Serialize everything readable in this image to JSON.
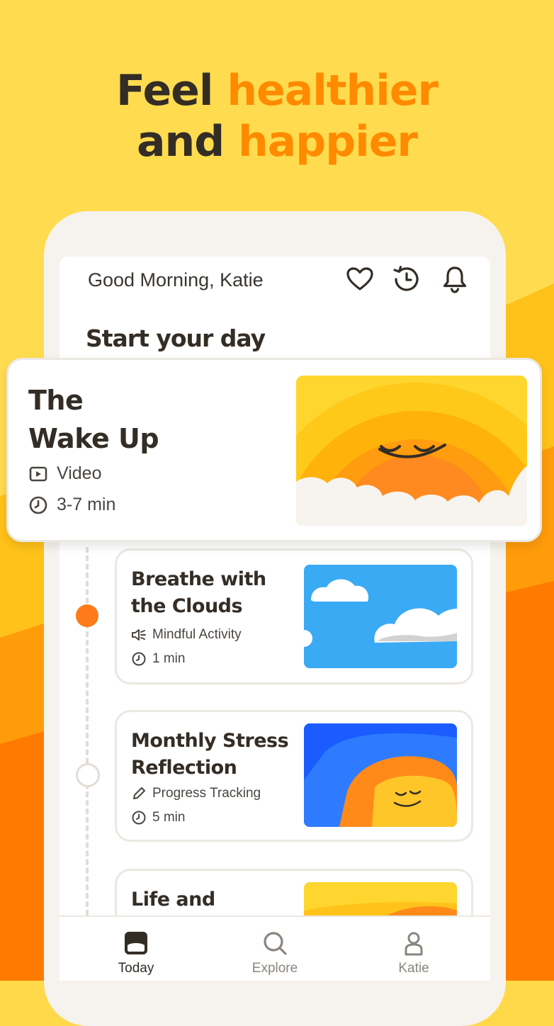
{
  "hero": {
    "line1_plain": "Feel ",
    "line1_accent": "healthier",
    "line2_plain": "and ",
    "line2_accent": "happier"
  },
  "header": {
    "greeting": "Good Morning, Katie",
    "icons": [
      "heart-icon",
      "history-icon",
      "bell-icon"
    ]
  },
  "section_title": "Start your day",
  "featured": {
    "title_line1": "The",
    "title_line2": "Wake Up",
    "type": "Video",
    "duration": "3-7 min"
  },
  "cards": [
    {
      "title_line1": "Breathe with",
      "title_line2": "the Clouds",
      "type": "Mindful Activity",
      "duration": "1 min",
      "completed": true
    },
    {
      "title_line1": "Monthly Stress",
      "title_line2": "Reflection",
      "type": "Progress Tracking",
      "duration": "5 min",
      "completed": false
    },
    {
      "title_line1": "Life and",
      "title_line2": ""
    }
  ],
  "nav": {
    "items": [
      {
        "label": "Today",
        "active": true
      },
      {
        "label": "Explore",
        "active": false
      },
      {
        "label": "Katie",
        "active": false
      }
    ]
  },
  "colors": {
    "accent": "#ff8a00",
    "yellow": "#ffd94a",
    "orange": "#ff7a00",
    "text": "#332d26"
  }
}
